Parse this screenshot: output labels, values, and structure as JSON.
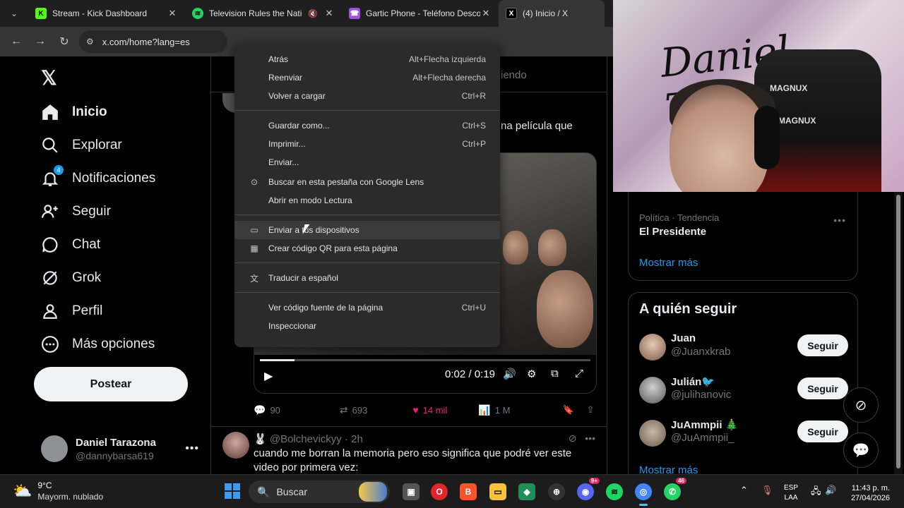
{
  "browser": {
    "tabs": [
      {
        "title": "Stream - Kick Dashboard",
        "icon": "kick-icon",
        "color": "#53fc18"
      },
      {
        "title": "Television Rules the Nation",
        "icon": "spotify-icon",
        "color": "#1ed760"
      },
      {
        "title": "Gartic Phone - Teléfono Descon",
        "icon": "gartic-icon",
        "color": "#a34fe0"
      },
      {
        "title": "(4) Inicio / X",
        "icon": "x-icon",
        "color": "#ffffff"
      }
    ],
    "url": "x.com/home?lang=es"
  },
  "context_menu": {
    "groups": [
      [
        {
          "label": "Atrás",
          "shortcut": "Alt+Flecha izquierda",
          "icon": ""
        },
        {
          "label": "Reenviar",
          "shortcut": "Alt+Flecha derecha",
          "icon": ""
        },
        {
          "label": "Volver a cargar",
          "shortcut": "Ctrl+R",
          "icon": ""
        }
      ],
      [
        {
          "label": "Guardar como...",
          "shortcut": "Ctrl+S",
          "icon": ""
        },
        {
          "label": "Imprimir...",
          "shortcut": "Ctrl+P",
          "icon": ""
        },
        {
          "label": "Enviar...",
          "shortcut": "",
          "icon": ""
        },
        {
          "label": "Buscar en esta pestaña con Google Lens",
          "shortcut": "",
          "icon": "google-lens-icon"
        },
        {
          "label": "Abrir en modo Lectura",
          "shortcut": "",
          "icon": ""
        }
      ],
      [
        {
          "label": "Enviar a tus dispositivos",
          "shortcut": "",
          "icon": "devices-icon"
        },
        {
          "label": "Crear código QR para esta página",
          "shortcut": "",
          "icon": "qr-code-icon"
        }
      ],
      [
        {
          "label": "Traducir a español",
          "shortcut": "",
          "icon": "translate-icon"
        }
      ],
      [
        {
          "label": "Ver código fuente de la página",
          "shortcut": "Ctrl+U",
          "icon": ""
        },
        {
          "label": "Inspeccionar",
          "shortcut": "",
          "icon": ""
        }
      ]
    ]
  },
  "x_sidebar": {
    "nav": [
      {
        "label": "Inicio",
        "icon": "home-icon",
        "bold": true
      },
      {
        "label": "Explorar",
        "icon": "search-icon"
      },
      {
        "label": "Notificaciones",
        "icon": "bell-icon",
        "badge": "4"
      },
      {
        "label": "Seguir",
        "icon": "add-person-icon"
      },
      {
        "label": "Chat",
        "icon": "chat-icon"
      },
      {
        "label": "Grok",
        "icon": "grok-icon"
      },
      {
        "label": "Perfil",
        "icon": "person-icon"
      },
      {
        "label": "Más opciones",
        "icon": "more-circle-icon"
      }
    ],
    "post_button": "Postear",
    "account": {
      "display_name": "Daniel Tarazona",
      "username": "@dannybarsa619"
    }
  },
  "feed": {
    "tab_fragment": "iendo",
    "tweet1": {
      "text_fragment": "na película que",
      "video": {
        "elapsed": "0:02",
        "duration": "0:19",
        "progress": 0.105
      },
      "stats": {
        "replies": "90",
        "reposts": "693",
        "likes": "14 mil",
        "views": "1 M"
      }
    },
    "tweet2": {
      "handle": "@Bolchevickyy",
      "time": "2h",
      "text": "cuando me borran la memoria pero eso significa que podré ver este video por primera vez:"
    }
  },
  "right_sidebar": {
    "trend": {
      "category": "Política · Tendencia",
      "name": "El Presidente"
    },
    "show_more": "Mostrar más",
    "who_to_follow": {
      "title": "A quién seguir",
      "follow_label": "Seguir",
      "users": [
        {
          "name": "Juan",
          "handle": "@Juanxkrab",
          "emoji": ""
        },
        {
          "name": "Julián",
          "handle": "@julihanovic",
          "emoji": "🐦"
        },
        {
          "name": "JuAmmpii",
          "handle": "@JuAmmpii_",
          "emoji": "🎄"
        }
      ]
    }
  },
  "webcam": {
    "graffiti": "Daniel Tarazona",
    "brand": "MAGNUX"
  },
  "taskbar": {
    "weather": {
      "temp": "9°C",
      "desc": "Mayorm. nublado"
    },
    "search": "Buscar",
    "badges": {
      "discord": "9+",
      "whatsapp": "46"
    },
    "lang": {
      "line1": "ESP",
      "line2": "LAA"
    },
    "clock": {
      "time": "11:43 p. m.",
      "date": "27/04/2026"
    }
  }
}
